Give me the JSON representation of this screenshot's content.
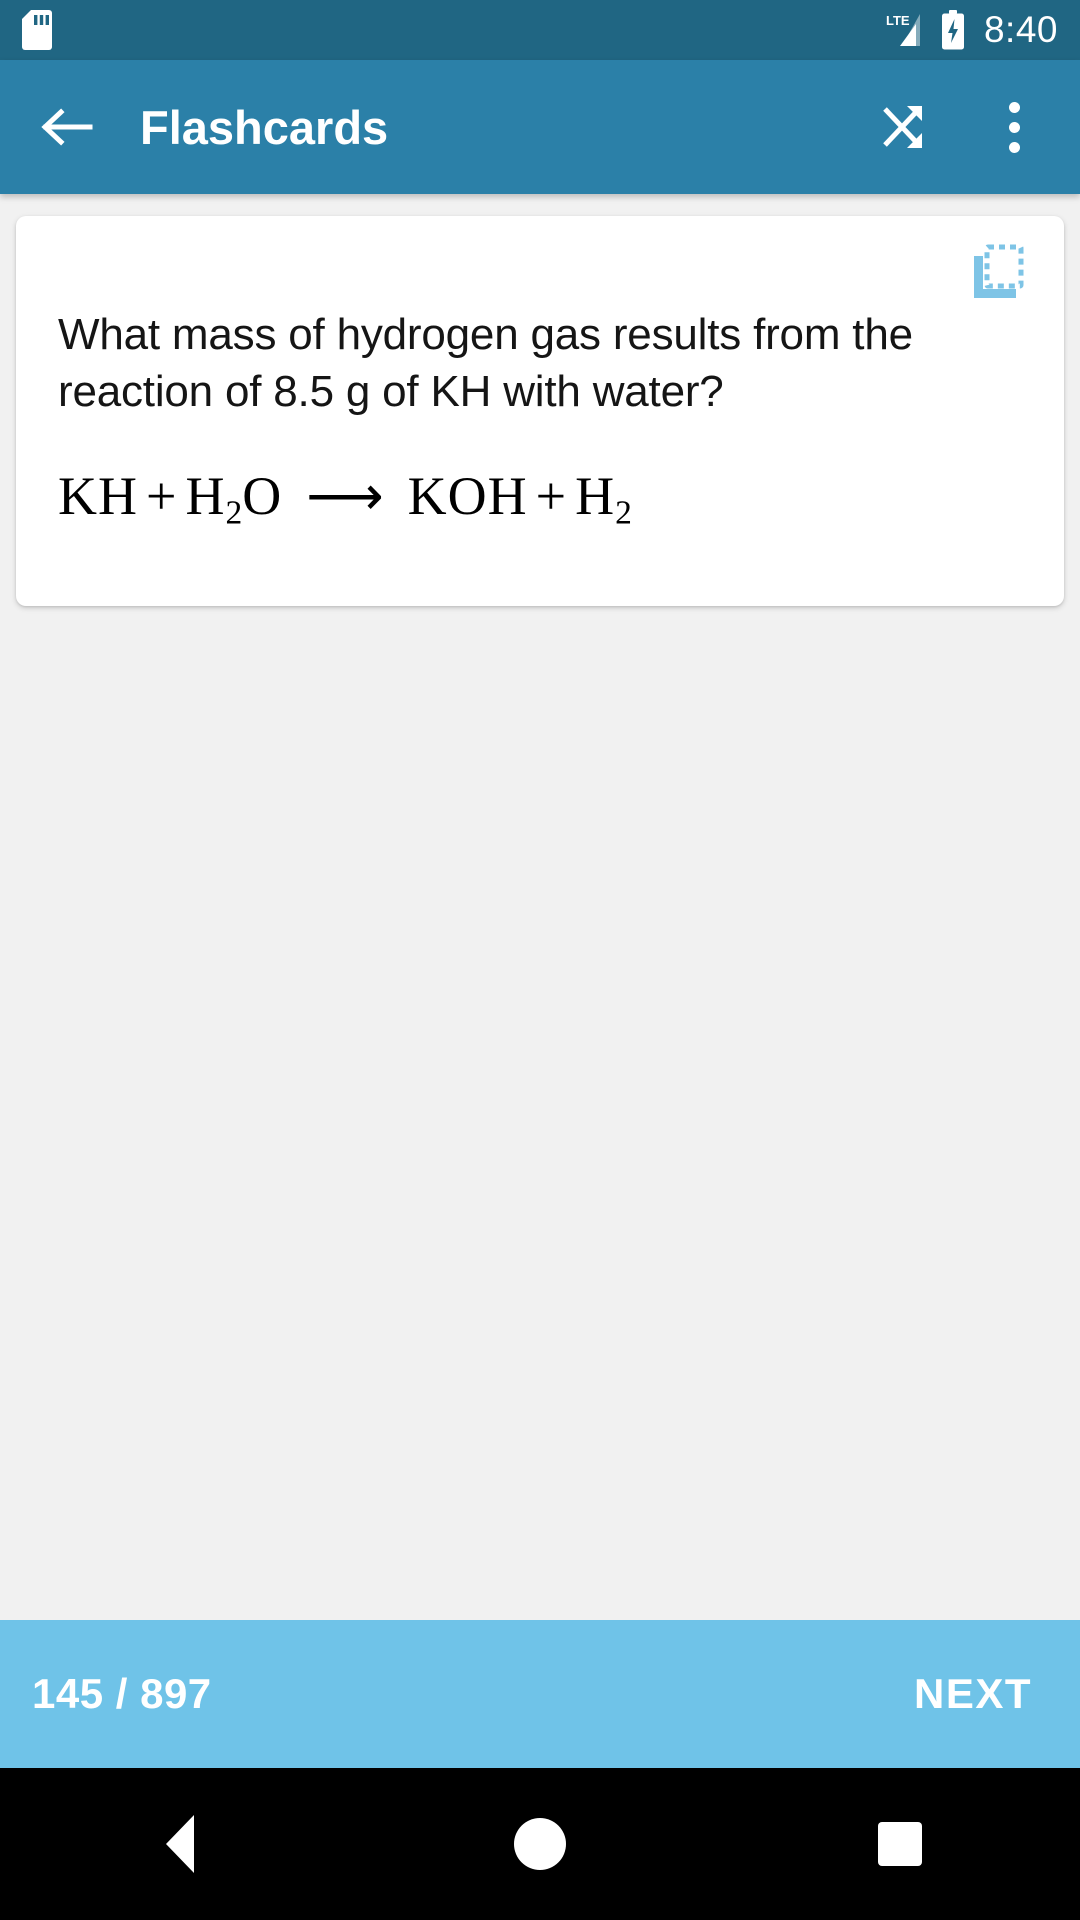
{
  "status_bar": {
    "sd_icon": "sd-card-icon",
    "signal_icon": "lte-signal-icon",
    "signal_label": "LTE",
    "battery_icon": "battery-charging-icon",
    "clock": "8:40",
    "background": "#206683"
  },
  "app_bar": {
    "back_icon": "back-arrow-icon",
    "title": "Flashcards",
    "shuffle_icon": "shuffle-icon",
    "overflow_icon": "overflow-menu-icon",
    "background": "#2b80a8"
  },
  "card": {
    "copy_icon": "copy-icon",
    "copy_icon_color": "#7ec4e6",
    "question": "What mass of hydrogen gas results from the reaction of 8.5 g of KH with water?",
    "equation": {
      "reactant_1": "KH",
      "operator_1": "+",
      "reactant_2_formula": "H",
      "reactant_2_sub": "2",
      "reactant_2_tail": "O",
      "arrow": "⟶",
      "product_1": "KOH",
      "operator_2": "+",
      "product_2_formula": "H",
      "product_2_sub": "2",
      "plain_text": "KH + H2O ⟶ KOH + H2"
    },
    "background": "#ffffff"
  },
  "footer": {
    "counter": "145 / 897",
    "current_index": "145",
    "total_count": "897",
    "next_label": "NEXT",
    "background": "#6fc3e8"
  },
  "nav_bar": {
    "back_icon": "nav-back-icon",
    "home_icon": "nav-home-icon",
    "recents_icon": "nav-recents-icon",
    "background": "#000000"
  },
  "page": {
    "background": "#f1f1f1"
  }
}
